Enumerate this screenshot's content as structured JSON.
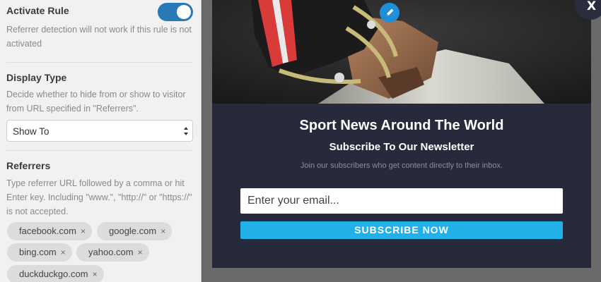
{
  "settings": {
    "activate_rule": {
      "title": "Activate Rule",
      "description": "Referrer detection will not work if this rule is not activated",
      "enabled": true
    },
    "display_type": {
      "title": "Display Type",
      "description": "Decide whether to hide from or show to visitor from URL specified in \"Referrers\".",
      "selected": "Show To"
    },
    "referrers": {
      "title": "Referrers",
      "description": "Type referrer URL followed by a comma or hit Enter key. Including \"www.\", \"http://\" or \"https://\" is not accepted.",
      "tags": [
        "facebook.com",
        "google.com",
        "bing.com",
        "yahoo.com",
        "duckduckgo.com"
      ],
      "remove_glyph": "×"
    }
  },
  "popup": {
    "title": "Sport News Around The World",
    "subtitle": "Subscribe To Our Newsletter",
    "description": "Join our subscribers who get content directly to their inbox.",
    "email_placeholder": "Enter your email...",
    "subscribe_label": "SUBSCRIBE NOW",
    "close_label": "X",
    "edit_icon": "pencil-icon"
  },
  "colors": {
    "toggle_on": "#2879b8",
    "popup_bg": "#272a3a",
    "subscribe_btn": "#22b0e8",
    "edit_badge": "#1e8fd8"
  }
}
